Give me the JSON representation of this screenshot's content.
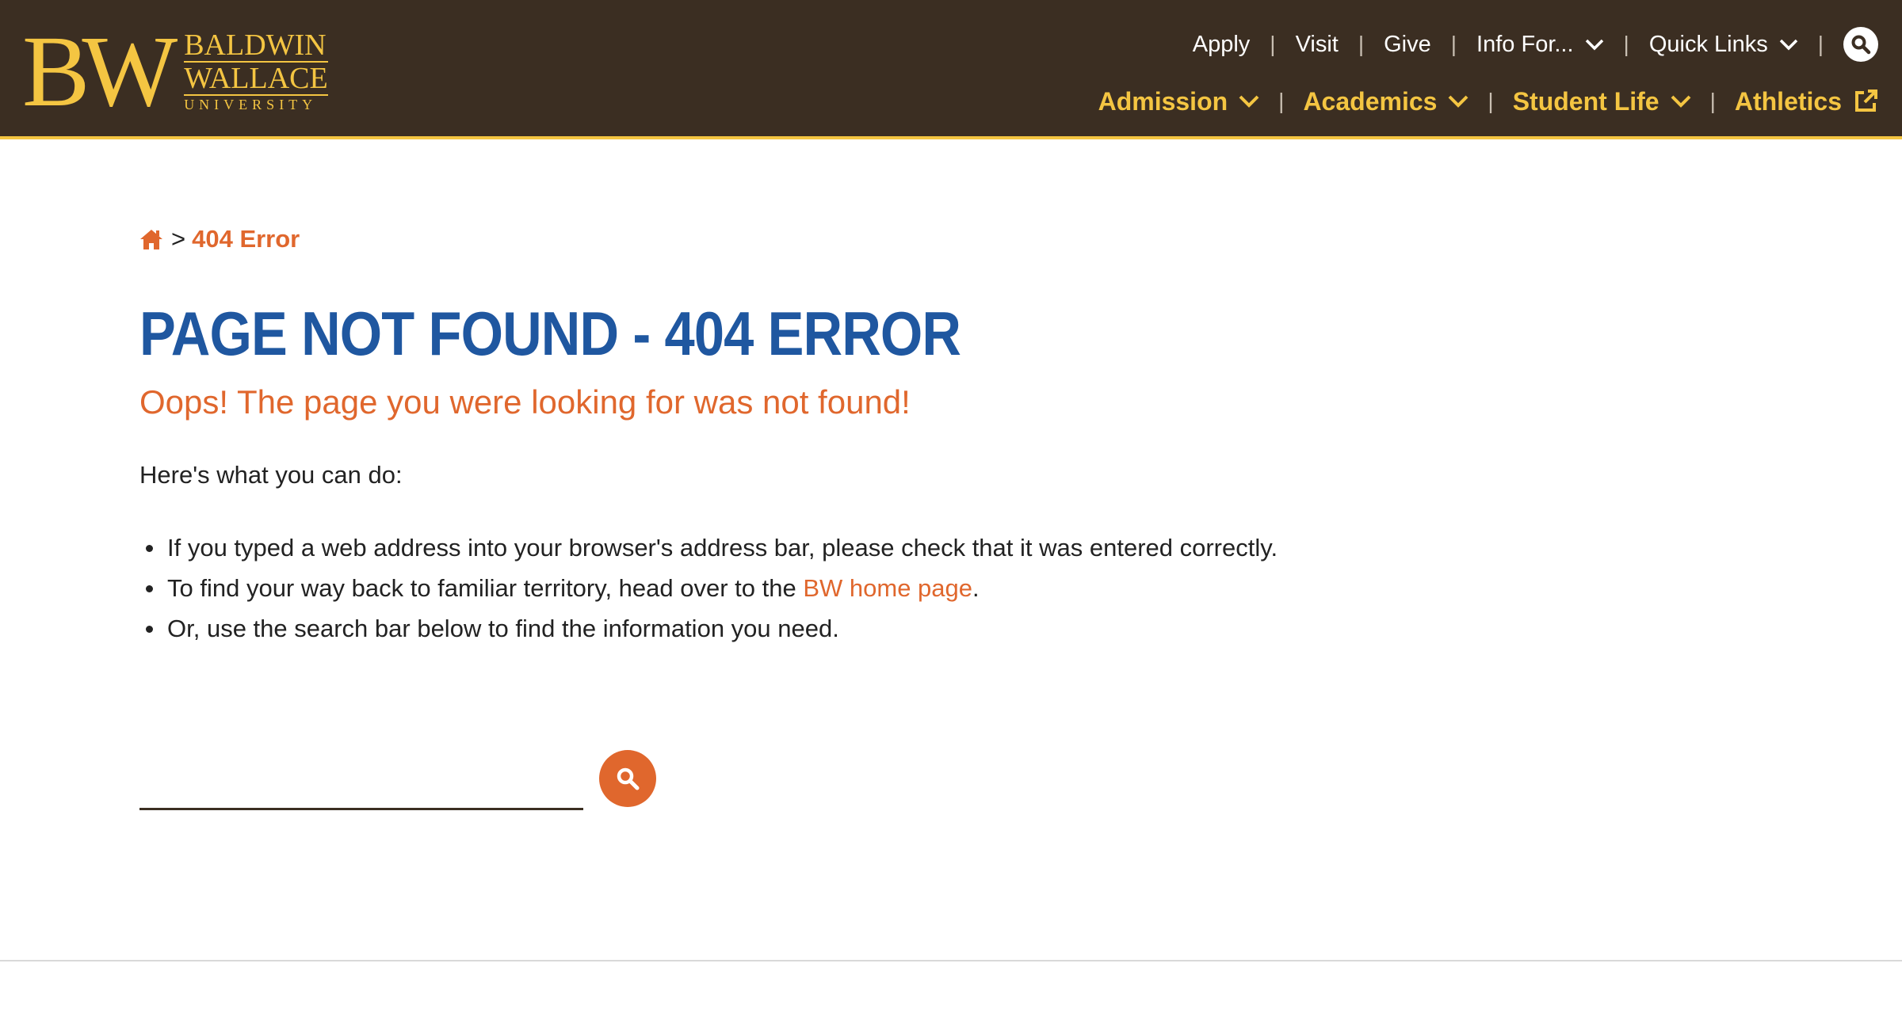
{
  "logo": {
    "mark": "BW",
    "line1": "BALDWIN",
    "line2": "WALLACE",
    "line3": "UNIVERSITY"
  },
  "utility_nav": {
    "apply": "Apply",
    "visit": "Visit",
    "give": "Give",
    "info_for": "Info For...",
    "quick_links": "Quick Links",
    "separator": "|"
  },
  "main_nav": {
    "admission": "Admission",
    "academics": "Academics",
    "student_life": "Student Life",
    "athletics": "Athletics",
    "separator": "|"
  },
  "breadcrumb": {
    "separator": ">",
    "current": "404 Error"
  },
  "page": {
    "title": "PAGE NOT FOUND - 404 ERROR",
    "subtitle": "Oops! The page you were looking for was not found!",
    "lead": "Here's what you can do:",
    "tip1": "If you typed a web address into your browser's address bar, please check that it was entered correctly.",
    "tip2_before": "To find your way back to familiar territory, head over to the ",
    "tip2_link": "BW home page",
    "tip2_after": ".",
    "tip3": "Or, use the search bar below to find the information you need."
  },
  "search": {
    "value": "",
    "placeholder": ""
  },
  "colors": {
    "header_bg": "#3b2e22",
    "gold": "#f4c542",
    "orange": "#e0672d",
    "title_blue": "#1f57a0"
  },
  "icons": {
    "home": "home-icon",
    "search": "search-icon",
    "chevron": "chevron-down-icon",
    "external": "external-link-icon"
  }
}
